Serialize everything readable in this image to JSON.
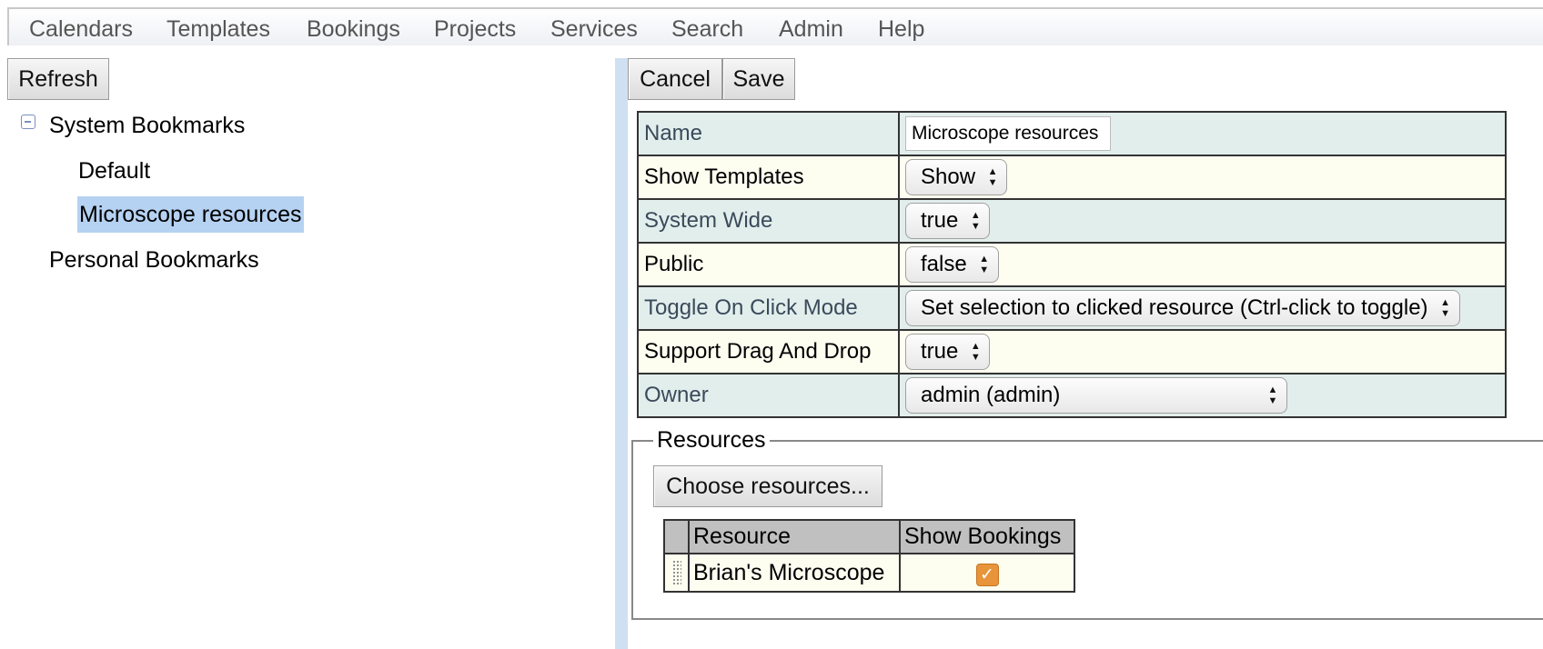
{
  "menu": {
    "items": [
      "Calendars",
      "Templates",
      "Bookings",
      "Projects",
      "Services",
      "Search",
      "Admin",
      "Help"
    ]
  },
  "left": {
    "refresh_label": "Refresh",
    "tree": {
      "system_label": "System Bookmarks",
      "system_children": [
        "Default",
        "Microscope resources"
      ],
      "personal_label": "Personal Bookmarks"
    }
  },
  "editor": {
    "cancel_label": "Cancel",
    "save_label": "Save",
    "fields": {
      "name": {
        "label": "Name",
        "value": "Microscope resources"
      },
      "show_templates": {
        "label": "Show Templates",
        "value": "Show"
      },
      "system_wide": {
        "label": "System Wide",
        "value": "true"
      },
      "public": {
        "label": "Public",
        "value": "false"
      },
      "toggle_mode": {
        "label": "Toggle On Click Mode",
        "value": "Set selection to clicked resource (Ctrl-click to toggle)"
      },
      "drag_drop": {
        "label": "Support Drag And Drop",
        "value": "true"
      },
      "owner": {
        "label": "Owner",
        "value": "admin (admin)"
      }
    },
    "resources": {
      "legend": "Resources",
      "choose_label": "Choose resources...",
      "columns": [
        "Resource",
        "Show Bookings"
      ],
      "rows": [
        {
          "resource": "Brian's Microscope",
          "show_bookings": true
        }
      ]
    }
  },
  "colors": {
    "selected_tree": "#b6d2f2",
    "row_even": "#e2eeec",
    "row_odd": "#fdfdf0",
    "checkbox": "#e8943a",
    "splitter": "#cfe0f2"
  }
}
